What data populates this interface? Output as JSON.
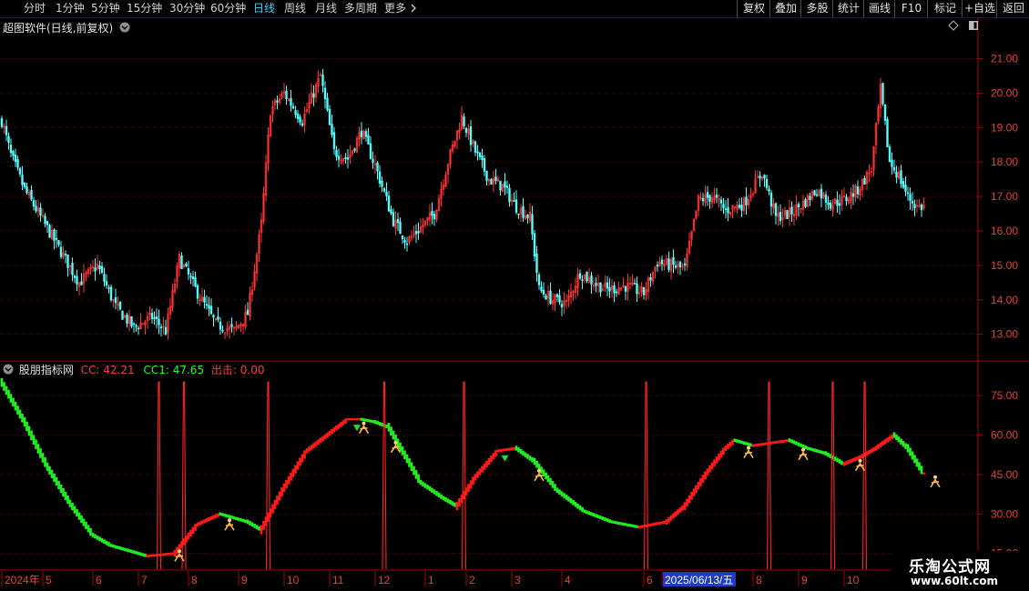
{
  "toolbar": {
    "periods": [
      {
        "label": "分时",
        "active": false
      },
      {
        "label": "1分钟",
        "active": false
      },
      {
        "label": "5分钟",
        "active": false
      },
      {
        "label": "15分钟",
        "active": false
      },
      {
        "label": "30分钟",
        "active": false
      },
      {
        "label": "60分钟",
        "active": false
      },
      {
        "label": "日线",
        "active": true
      },
      {
        "label": "周线",
        "active": false
      },
      {
        "label": "月线",
        "active": false
      },
      {
        "label": "多周期",
        "active": false
      },
      {
        "label": "更多",
        "active": false
      }
    ],
    "more_icon": "chevron-right-icon",
    "right_buttons": [
      "复权",
      "叠加",
      "多股",
      "统计",
      "画线",
      "F10",
      "标记",
      "+自选",
      "返回"
    ]
  },
  "main_panel": {
    "title": "超图软件(日线,前复权)",
    "title_icon": "circle-chevron-down-icon",
    "tool_icons": [
      "diamond-icon",
      "window-toggle-icon"
    ]
  },
  "indicator_panel": {
    "title": "股朋指标网",
    "title_icon": "circle-chevron-down-icon",
    "cc_label": "CC: 42.21",
    "cc1_label": "CC1: 47.65",
    "out_label": "出击: 0.00"
  },
  "colors": {
    "up": "#ff3232",
    "down": "#54ffff",
    "grid": "#7a0000",
    "frame": "#b00000",
    "axis_text": "#e8412a",
    "cc_up": "#ff1a1a",
    "cc_down": "#22ee22",
    "signal": "#ff2020",
    "cc_label": "#ff3c3c",
    "cc1_label": "#22ff22",
    "out_label": "#ff3c3c",
    "date_highlight_bg": "#1f3cbf"
  },
  "watermark": {
    "title": "乐淘公式网",
    "url": "www.60lt.com"
  },
  "chart_data": [
    {
      "type": "candlestick",
      "y_ticks": [
        "21.00",
        "20.00",
        "19.00",
        "18.00",
        "17.00",
        "16.00",
        "15.00",
        "14.00",
        "13.00"
      ],
      "ylim": [
        12.2,
        21.7
      ],
      "anchors": [
        [
          0,
          19.2
        ],
        [
          4,
          18.2
        ],
        [
          10,
          17.2
        ],
        [
          18,
          16.3
        ],
        [
          26,
          15.4
        ],
        [
          34,
          14.5
        ],
        [
          42,
          15.0
        ],
        [
          50,
          13.8
        ],
        [
          58,
          13.2
        ],
        [
          66,
          13.5
        ],
        [
          72,
          13.1
        ],
        [
          78,
          15.2
        ],
        [
          86,
          14.2
        ],
        [
          94,
          13.3
        ],
        [
          102,
          13.1
        ],
        [
          108,
          13.6
        ],
        [
          114,
          16.2
        ],
        [
          118,
          19.5
        ],
        [
          124,
          20.0
        ],
        [
          132,
          19.2
        ],
        [
          140,
          20.5
        ],
        [
          146,
          18.3
        ],
        [
          152,
          18.1
        ],
        [
          158,
          18.9
        ],
        [
          164,
          17.9
        ],
        [
          172,
          16.3
        ],
        [
          178,
          15.7
        ],
        [
          184,
          16.1
        ],
        [
          190,
          16.5
        ],
        [
          196,
          18.0
        ],
        [
          202,
          19.3
        ],
        [
          208,
          18.3
        ],
        [
          214,
          17.5
        ],
        [
          220,
          17.3
        ],
        [
          226,
          16.7
        ],
        [
          232,
          16.4
        ],
        [
          236,
          14.3
        ],
        [
          242,
          14.0
        ],
        [
          248,
          13.9
        ],
        [
          254,
          14.8
        ],
        [
          260,
          14.5
        ],
        [
          266,
          14.3
        ],
        [
          274,
          14.4
        ],
        [
          282,
          14.2
        ],
        [
          288,
          15.1
        ],
        [
          294,
          15.0
        ],
        [
          300,
          14.9
        ],
        [
          306,
          16.9
        ],
        [
          312,
          17.0
        ],
        [
          318,
          16.6
        ],
        [
          326,
          16.8
        ],
        [
          334,
          17.7
        ],
        [
          340,
          16.4
        ],
        [
          346,
          16.5
        ],
        [
          352,
          16.8
        ],
        [
          358,
          17.2
        ],
        [
          364,
          16.8
        ],
        [
          370,
          16.9
        ],
        [
          376,
          17.2
        ],
        [
          382,
          17.8
        ],
        [
          386,
          20.1
        ],
        [
          390,
          18.0
        ],
        [
          394,
          17.6
        ],
        [
          398,
          17.0
        ],
        [
          402,
          16.7
        ],
        [
          405,
          16.7
        ]
      ],
      "x_labels": [
        {
          "bar": 0,
          "text": "2024年"
        },
        {
          "bar": 18,
          "text": "5"
        },
        {
          "bar": 40,
          "text": "6"
        },
        {
          "bar": 60,
          "text": "7"
        },
        {
          "bar": 82,
          "text": "8"
        },
        {
          "bar": 104,
          "text": "9"
        },
        {
          "bar": 124,
          "text": "10"
        },
        {
          "bar": 144,
          "text": "11"
        },
        {
          "bar": 164,
          "text": "12"
        },
        {
          "bar": 186,
          "text": "1"
        },
        {
          "bar": 204,
          "text": "2"
        },
        {
          "bar": 224,
          "text": "3"
        },
        {
          "bar": 246,
          "text": "4"
        },
        {
          "bar": 282,
          "text": "6"
        },
        {
          "bar": 290,
          "text": "2025/06/13/五",
          "highlight": true
        },
        {
          "bar": 330,
          "text": "8"
        },
        {
          "bar": 350,
          "text": "9"
        },
        {
          "bar": 370,
          "text": "10"
        }
      ]
    },
    {
      "type": "area",
      "name": "CC",
      "y_ticks": [
        "75.00",
        "60.00",
        "45.00",
        "30.00",
        "15.00"
      ],
      "ylim": [
        9,
        83
      ],
      "cc_points": [
        [
          0,
          80
        ],
        [
          10,
          65
        ],
        [
          20,
          48
        ],
        [
          30,
          34
        ],
        [
          40,
          22
        ],
        [
          48,
          18
        ],
        [
          56,
          16
        ],
        [
          64,
          14
        ],
        [
          76,
          15
        ],
        [
          86,
          26
        ],
        [
          96,
          30
        ],
        [
          108,
          27
        ],
        [
          114,
          24
        ],
        [
          124,
          40
        ],
        [
          134,
          54
        ],
        [
          146,
          62
        ],
        [
          152,
          66
        ],
        [
          158,
          66
        ],
        [
          164,
          65
        ],
        [
          170,
          63
        ],
        [
          176,
          54
        ],
        [
          184,
          42
        ],
        [
          194,
          36
        ],
        [
          200,
          33
        ],
        [
          208,
          44
        ],
        [
          218,
          54
        ],
        [
          226,
          55
        ],
        [
          234,
          50
        ],
        [
          244,
          39
        ],
        [
          256,
          31
        ],
        [
          268,
          27
        ],
        [
          280,
          25
        ],
        [
          292,
          27
        ],
        [
          300,
          33
        ],
        [
          310,
          46
        ],
        [
          318,
          55
        ],
        [
          322,
          58
        ],
        [
          330,
          56
        ],
        [
          338,
          57
        ],
        [
          346,
          58
        ],
        [
          354,
          55
        ],
        [
          362,
          53
        ],
        [
          370,
          49
        ],
        [
          378,
          52
        ],
        [
          384,
          55
        ],
        [
          392,
          60
        ],
        [
          398,
          55
        ],
        [
          406,
          44
        ]
      ],
      "signal_bars": [
        69,
        80,
        117,
        168,
        203,
        283,
        337,
        365,
        379
      ]
    }
  ]
}
